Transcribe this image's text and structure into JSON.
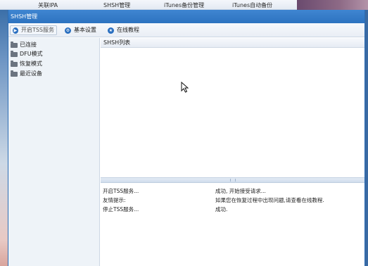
{
  "background_app": {
    "tabs": [
      "关联IPA",
      "SHSH管理",
      "iTunes备份管理",
      "iTunes自动备份"
    ]
  },
  "dialog": {
    "title": "SHSH管理",
    "toolbar": {
      "start_tss": "开启TSS服务",
      "basic_settings": "基本设置",
      "online_tutorial": "在线教程"
    },
    "tree": [
      "已连接",
      "DFU模式",
      "恢复模式",
      "最近设备"
    ],
    "list_header": "SHSH列表",
    "log": [
      {
        "event": "开启TSS服务...",
        "message": "成功, 开始接受请求..."
      },
      {
        "event": "友情提示:",
        "message": "如果您在恢复过程中出现问题,请查看在线教程."
      },
      {
        "event": "停止TSS服务...",
        "message": "成功."
      }
    ]
  },
  "colors": {
    "titlebar": "#2d73c0",
    "tree_bg": "#eef3f8",
    "accent_icon": "#2a6fc0"
  }
}
